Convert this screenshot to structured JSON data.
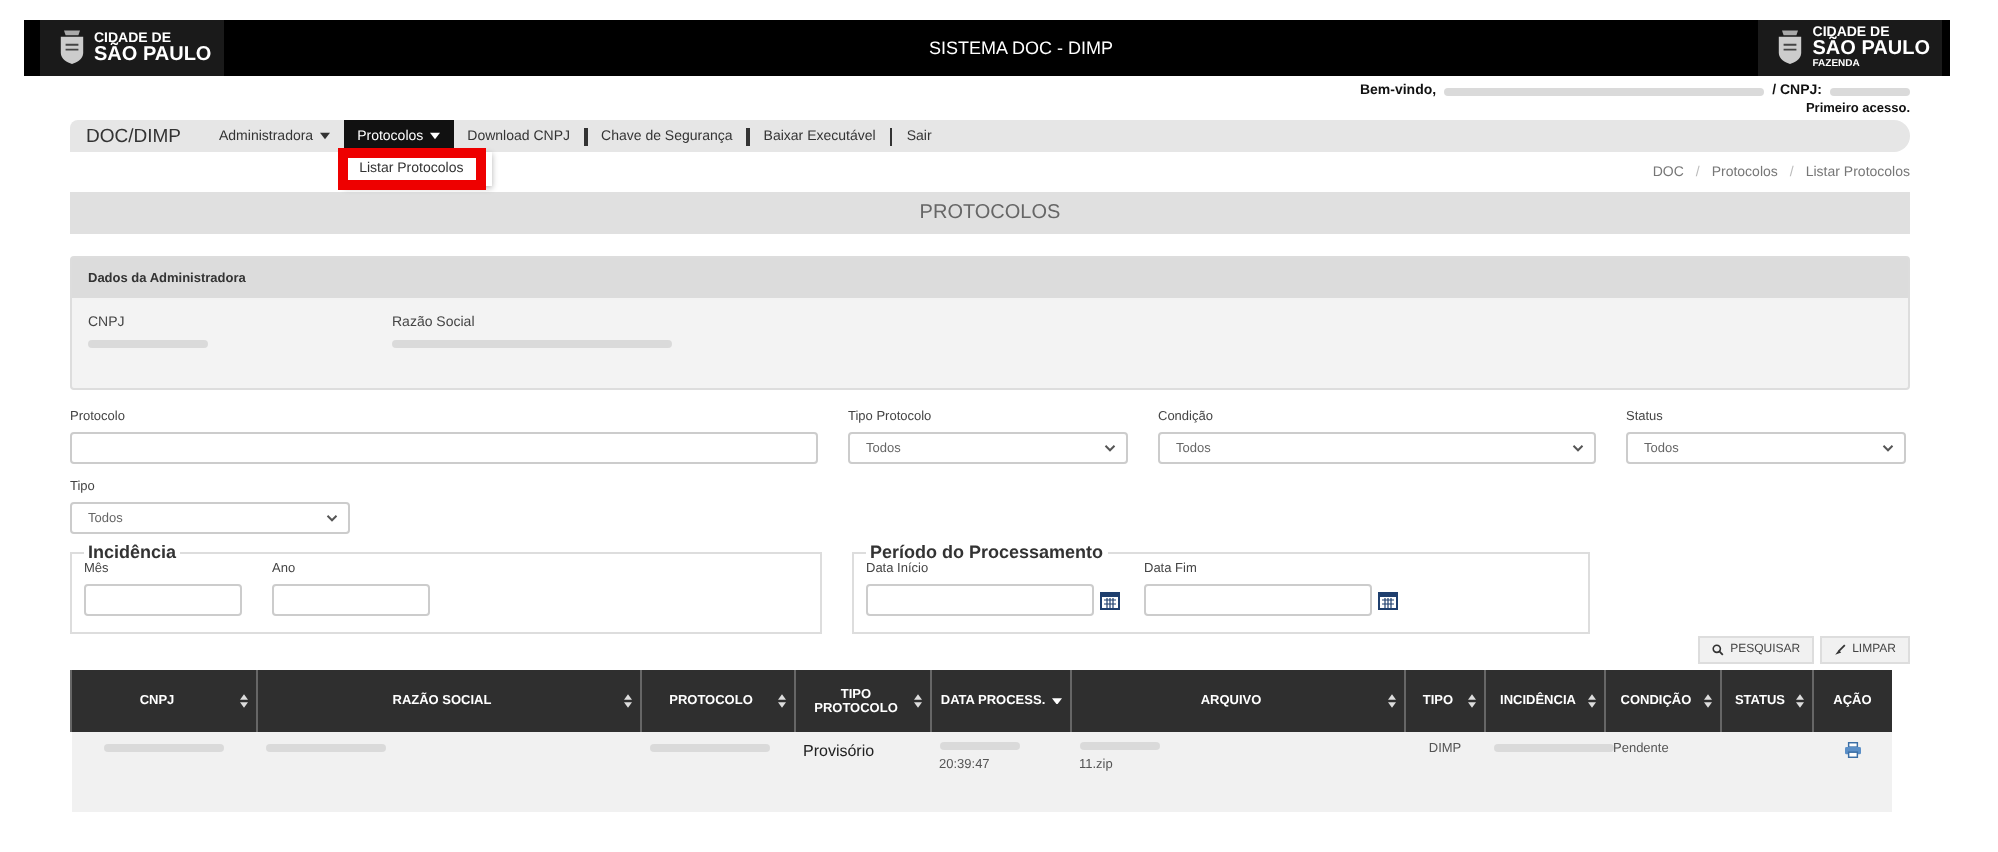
{
  "header": {
    "logo_left": {
      "line1": "CIDADE DE",
      "line2": "SÃO PAULO"
    },
    "title": "SISTEMA DOC - DIMP",
    "logo_right": {
      "line1": "CIDADE DE",
      "line2": "SÃO PAULO",
      "line3": "FAZENDA"
    }
  },
  "user_bar": {
    "welcome": "Bem-vindo,",
    "welcome_redacted": true,
    "cnpj_label": "/ CNPJ:",
    "cnpj_redacted": true,
    "note": "Primeiro acesso."
  },
  "nav": {
    "brand": "DOC/DIMP",
    "items": [
      {
        "label": "Administradora",
        "caret": true,
        "selected": false
      },
      {
        "label": "Protocolos",
        "caret": true,
        "selected": true
      },
      {
        "label": "Download CNPJ",
        "caret": false,
        "selected": false
      },
      {
        "label": "Chave de Segurança",
        "caret": false,
        "selected": false
      },
      {
        "label": "Baixar Executável",
        "caret": false,
        "selected": false
      },
      {
        "label": "Sair",
        "caret": false,
        "selected": false
      }
    ],
    "dropdown": {
      "items": [
        {
          "label": "Listar Protocolos",
          "highlighted": true
        }
      ]
    }
  },
  "breadcrumb": {
    "separator": "/",
    "items": [
      "DOC",
      "Protocolos",
      "Listar Protocolos"
    ]
  },
  "page_title": "PROTOCOLOS",
  "admin_panel": {
    "title": "Dados da Administradora",
    "fields": [
      {
        "label": "CNPJ",
        "redacted": true
      },
      {
        "label": "Razão Social",
        "redacted": true
      }
    ]
  },
  "filters": {
    "protocolo": {
      "label": "Protocolo"
    },
    "tipo_protocolo": {
      "label": "Tipo Protocolo",
      "value": "Todos"
    },
    "condicao": {
      "label": "Condição",
      "value": "Todos"
    },
    "status": {
      "label": "Status",
      "value": "Todos"
    },
    "tipo": {
      "label": "Tipo",
      "value": "Todos"
    },
    "incidencia": {
      "legend": "Incidência",
      "mes": "Mês",
      "ano": "Ano"
    },
    "periodo": {
      "legend": "Período do Processamento",
      "inicio": "Data Início",
      "fim": "Data Fim"
    }
  },
  "buttons": [
    {
      "label": "PESQUISAR",
      "kind": "search"
    },
    {
      "label": "LIMPAR",
      "kind": "clear"
    }
  ],
  "table": {
    "columns": [
      {
        "label": "CNPJ",
        "sortable": true,
        "sorted": false
      },
      {
        "label": "RAZÃO SOCIAL",
        "sortable": true,
        "sorted": false
      },
      {
        "label": "PROTOCOLO",
        "sortable": true,
        "sorted": false
      },
      {
        "label": "TIPO PROTOCOLO",
        "sortable": true,
        "sorted": false
      },
      {
        "label": "DATA PROCESS.",
        "sortable": true,
        "sorted": true
      },
      {
        "label": "ARQUIVO",
        "sortable": true,
        "sorted": false
      },
      {
        "label": "TIPO",
        "sortable": true,
        "sorted": false
      },
      {
        "label": "INCIDÊNCIA",
        "sortable": true,
        "sorted": false
      },
      {
        "label": "CONDIÇÃO",
        "sortable": true,
        "sorted": false
      },
      {
        "label": "STATUS",
        "sortable": true,
        "sorted": false
      },
      {
        "label": "AÇÃO",
        "sortable": false
      }
    ],
    "rows": [
      {
        "cells": [
          {
            "kind": "redacted"
          },
          {
            "kind": "redacted"
          },
          {
            "kind": "redacted"
          },
          {
            "kind": "text",
            "text": "Provisório",
            "strong": true
          },
          {
            "kind": "partial",
            "text": "20:39:47"
          },
          {
            "kind": "partial",
            "text": "11.zip"
          },
          {
            "kind": "text",
            "text": "DIMP",
            "strong": false
          },
          {
            "kind": "redacted"
          },
          {
            "kind": "text",
            "text": "Pendente",
            "strong": false
          },
          {
            "kind": "empty"
          },
          {
            "kind": "action"
          }
        ]
      }
    ]
  }
}
